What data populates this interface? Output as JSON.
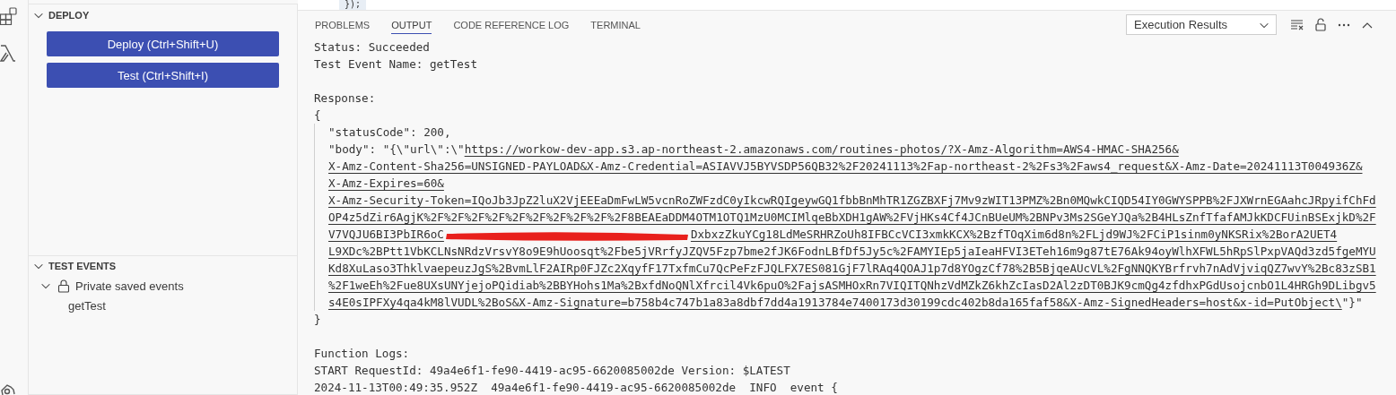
{
  "editor_fragment": {
    "code": "});"
  },
  "sidebar": {
    "sections": [
      {
        "title": "DEPLOY",
        "expanded": true,
        "buttons": [
          "Deploy (Ctrl+Shift+U)",
          "Test (Ctrl+Shift+I)"
        ]
      },
      {
        "title": "TEST EVENTS",
        "expanded": true,
        "tree": [
          {
            "label": "Private saved events",
            "expanded": true,
            "children": [
              {
                "label": "getTest"
              }
            ]
          }
        ]
      }
    ]
  },
  "panel": {
    "tabs": [
      {
        "label": "PROBLEMS",
        "selected": false
      },
      {
        "label": "OUTPUT",
        "selected": true
      },
      {
        "label": "CODE REFERENCE LOG",
        "selected": false
      },
      {
        "label": "TERMINAL",
        "selected": false
      }
    ],
    "dropdown": {
      "value": "Execution Results"
    },
    "output": [
      {
        "kind": "plain",
        "text": "Status: Succeeded"
      },
      {
        "kind": "plain",
        "text": "Test Event Name: getTest"
      },
      {
        "kind": "blank"
      },
      {
        "kind": "plain",
        "text": "Response:"
      },
      {
        "kind": "plain",
        "text": "{"
      },
      {
        "kind": "block",
        "children": [
          {
            "kind": "plain",
            "text": "\"statusCode\": 200,"
          },
          {
            "kind": "link",
            "prefix": "\"body\": \"{\\\"url\\\":\\\"",
            "text": "https://workow-dev-app.s3.ap-northeast-2.amazonaws.com/routines-photos/?X-Amz-Algorithm=AWS4-HMAC-SHA256&"
          },
          {
            "kind": "link",
            "text": "X-Amz-Content-Sha256=UNSIGNED-PAYLOAD&X-Amz-Credential=ASIAVVJ5BYVSDP56QB32%2F20241113%2Fap-northeast-2%2Fs3%2Faws4_request&X-Amz-Date=20241113T004936Z&"
          },
          {
            "kind": "link",
            "text": "X-Amz-Expires=60&"
          },
          {
            "kind": "link",
            "text": "X-Amz-Security-Token=IQoJb3JpZ2luX2VjEEEaDmFwLW5vcnRoZWFzdC0yIkcwRQIgeywGQ1fbbBnMhTR1ZGZBXFj7Mv9zWIT13PMZ%2Bn0MQwkCIQD54IY0GWYSPPB%2FJXWrnEGAahcJRpyifChFd"
          },
          {
            "kind": "link",
            "text": "OP4z5dZir6AgjK%2F%2F%2F%2F%2F%2F%2F%2F%2F%2F8BEAEaDDM4OTM1OTQ1MzU0MCIMlqeBbXDH1gAW%2FVjHKs4Cf4JCnBUeUM%2BNPv3Ms2SGeYJQa%2B4HLsZnfTfafAMJkKDCFUinBSExjkD%2F"
          },
          {
            "kind": "redacted",
            "parts": [
              "V7VQJU6BI3PbIR6oC",
              "DxbxzZkuYCg18LdMeSRHRZoUh8IFBCcVCI3xmkKCX%2BzfTOqXim6d8n%2FLjd9WJ%2FCiP1sinm0yNKSRix%2BorA2UET4"
            ]
          },
          {
            "kind": "link",
            "text": "L9XDc%2BPtt1VbKCLNsNRdzVrsvY8o9E9hUoosqt%2Fbe5jVRrfyJZQV5Fzp7bme2fJK6FodnLBfDf5Jy5c%2FAMYIEp5jaIeaHFVI3ETeh16m9g87tE76Ak94oyWlhXFWL5hRpSlPxpVAQd3zd5fgeMYU"
          },
          {
            "kind": "link",
            "text": "Kd8XuLaso3ThklvaepeuzJgS%2BvmLlF2AIRp0FJZc2XqyfF17TxfmCu7QcPeFzFJQLFX7ES081GjF7lRAq4QOAJ1p7d8YOgzCf78%2B5BjqeAUcVL%2FgNNQKYBrfrvh7nAdVjviqQZ7wvY%2Bc83zSB1"
          },
          {
            "kind": "link",
            "text": "%2F1weEh%2Fue8UXsUNYjejoPQidiab%2BBYHohs1Ma%2BxfdNoQNlXfrcil4Vk6puO%2FajsASMHOxRn7VIQITQNhzVdMZkZ6khZcIasD2Al2zDT0BJK9cmQg4zfdhxPGdUsojcnbO1L4HRGh9DLibgv5"
          },
          {
            "kind": "link",
            "text": "s4E0sIPFXy4qa4kM8lVUDL%2BoS&X-Amz-Signature=b758b4c747b1a83a8dbf7dd4a1913784e7400173d30199cdc402b8da165faf58&X-Amz-SignedHeaders=host&x-id=PutObject\\",
            "suffix": "\"}\""
          }
        ]
      },
      {
        "kind": "plain",
        "text": "}"
      },
      {
        "kind": "blank"
      },
      {
        "kind": "plain",
        "text": "Function Logs:"
      },
      {
        "kind": "plain",
        "text": "START RequestId: 49a4e6f1-fe90-4419-ac95-6620085002de Version: $LATEST"
      },
      {
        "kind": "plain",
        "text": "2024-11-13T00:49:35.952Z  49a4e6f1-fe90-4419-ac95-6620085002de  INFO  event {"
      }
    ]
  }
}
